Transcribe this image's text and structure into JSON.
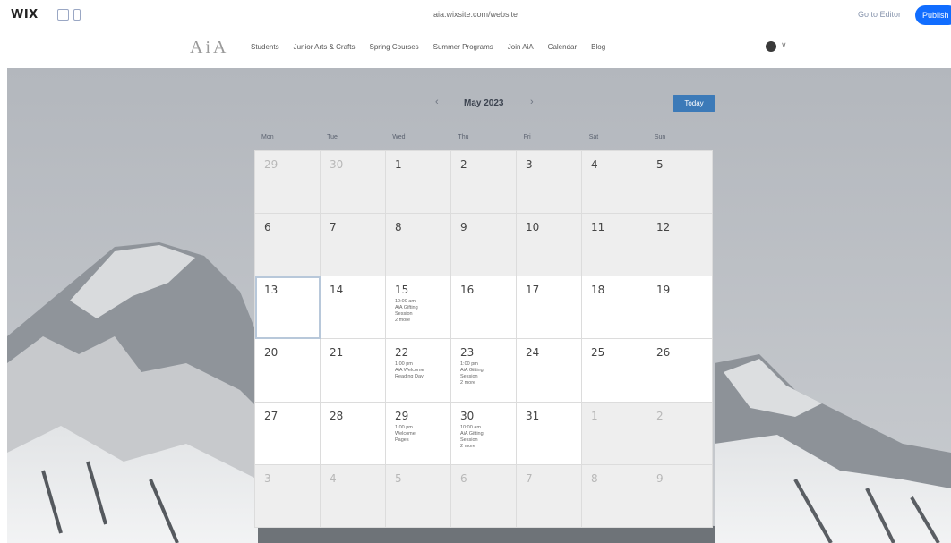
{
  "wixbar": {
    "logo": "WIX",
    "site_url": "aia.wixsite.com/website",
    "upgrade_label": "Go to Editor",
    "publish_label": "Publish"
  },
  "site": {
    "logo": "AiA",
    "nav": [
      "Students",
      "Junior Arts & Crafts",
      "Spring Courses",
      "Summer Programs",
      "Join AiA",
      "Calendar",
      "Blog"
    ],
    "user_icon": "user-icon",
    "user_caret": "∨"
  },
  "calendar": {
    "prev": "‹",
    "month_label": "May 2023",
    "next": "›",
    "today_label": "Today",
    "weekdays": [
      "Mon",
      "Tue",
      "Wed",
      "Thu",
      "Fri",
      "Sat",
      "Sun"
    ],
    "weeks": [
      [
        {
          "day": "29",
          "other": true
        },
        {
          "day": "30",
          "other": true
        },
        {
          "day": "1"
        },
        {
          "day": "2"
        },
        {
          "day": "3"
        },
        {
          "day": "4"
        },
        {
          "day": "5"
        }
      ],
      [
        {
          "day": "6"
        },
        {
          "day": "7"
        },
        {
          "day": "8"
        },
        {
          "day": "9"
        },
        {
          "day": "10"
        },
        {
          "day": "11"
        },
        {
          "day": "12"
        }
      ],
      [
        {
          "day": "13",
          "today": true,
          "cur": true
        },
        {
          "day": "14",
          "cur": true
        },
        {
          "day": "15",
          "cur": true,
          "event": [
            "10:00 am",
            "AiA Gifting",
            "Session",
            "2 more"
          ]
        },
        {
          "day": "16",
          "cur": true
        },
        {
          "day": "17",
          "cur": true
        },
        {
          "day": "18",
          "cur": true
        },
        {
          "day": "19",
          "cur": true
        }
      ],
      [
        {
          "day": "20",
          "cur": true
        },
        {
          "day": "21",
          "cur": true
        },
        {
          "day": "22",
          "cur": true,
          "event": [
            "1:00 pm",
            "AiA Welcome",
            "Reading Day"
          ]
        },
        {
          "day": "23",
          "cur": true,
          "event": [
            "1:00 pm",
            "AiA Gifting",
            "Session",
            "2 more"
          ]
        },
        {
          "day": "24",
          "cur": true
        },
        {
          "day": "25",
          "cur": true
        },
        {
          "day": "26",
          "cur": true
        }
      ],
      [
        {
          "day": "27",
          "cur": true
        },
        {
          "day": "28",
          "cur": true
        },
        {
          "day": "29",
          "cur": true,
          "event": [
            "1:00 pm",
            "Welcome",
            "Pages"
          ]
        },
        {
          "day": "30",
          "cur": true,
          "event": [
            "10:00 am",
            "AiA Gifting",
            "Session",
            "2 more"
          ]
        },
        {
          "day": "31",
          "cur": true
        },
        {
          "day": "1",
          "other": true
        },
        {
          "day": "2",
          "other": true
        }
      ],
      [
        {
          "day": "3",
          "other": true
        },
        {
          "day": "4",
          "other": true
        },
        {
          "day": "5",
          "other": true
        },
        {
          "day": "6",
          "other": true
        },
        {
          "day": "7",
          "other": true
        },
        {
          "day": "8",
          "other": true
        },
        {
          "day": "9",
          "other": true
        }
      ]
    ]
  }
}
